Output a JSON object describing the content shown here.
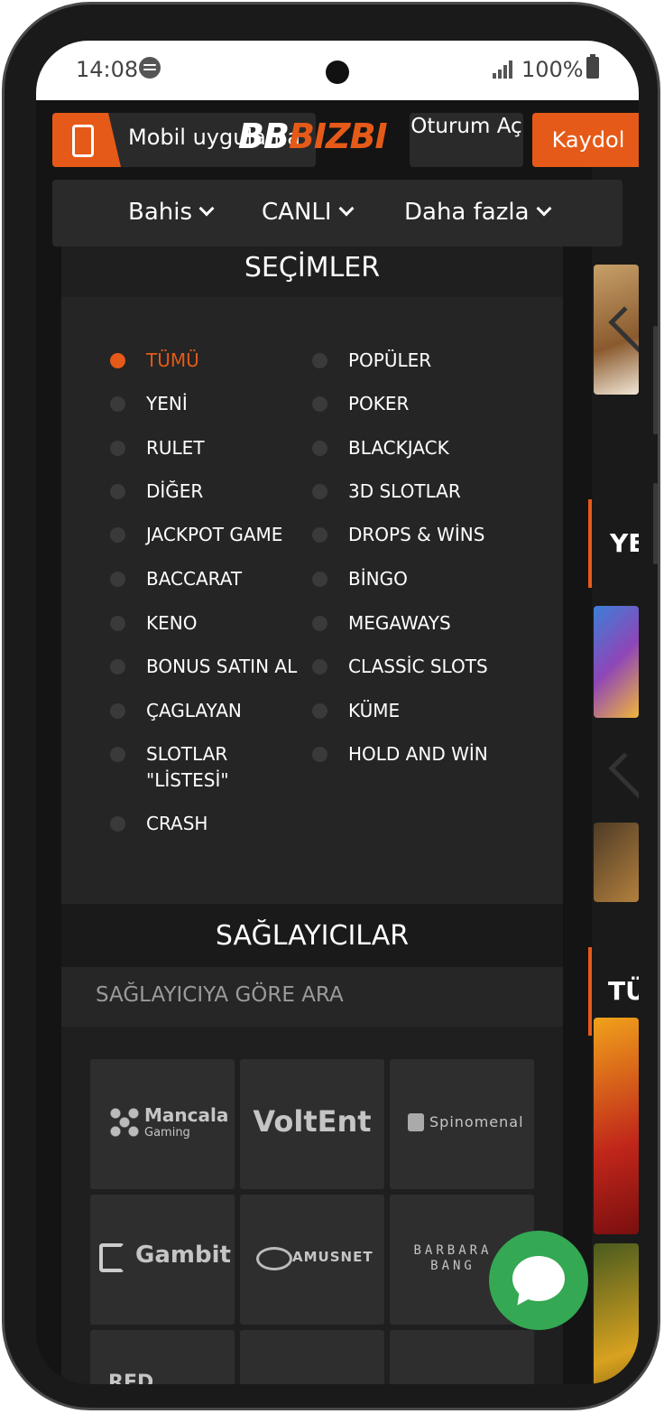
{
  "status_bar": {
    "time": "14:08",
    "battery": "100%"
  },
  "header": {
    "mobile_app_label": "Mobil uygulama",
    "logo_left": "BB",
    "logo_text": "BIZBI",
    "login_label": "Oturum Aç",
    "signup_label": "Kaydol"
  },
  "nav": {
    "items": [
      {
        "label": "Bahis"
      },
      {
        "label": "CANLI"
      },
      {
        "label": "Daha fazla"
      }
    ]
  },
  "selections": {
    "title": "SEÇİMLER",
    "filters": [
      {
        "label": "TÜMÜ",
        "active": true
      },
      {
        "label": "POPÜLER"
      },
      {
        "label": "YENİ"
      },
      {
        "label": "POKER"
      },
      {
        "label": "RULET"
      },
      {
        "label": "BLACKJACK"
      },
      {
        "label": "DİĞER"
      },
      {
        "label": "3D SLOTLAR"
      },
      {
        "label": "JACKPOT GAME"
      },
      {
        "label": "DROPS & WİNS"
      },
      {
        "label": "BACCARAT"
      },
      {
        "label": "BİNGO"
      },
      {
        "label": "KENO"
      },
      {
        "label": "MEGAWAYS"
      },
      {
        "label": "BONUS SATIN AL"
      },
      {
        "label": "CLASSİC SLOTS"
      },
      {
        "label": "ÇAGLAYAN"
      },
      {
        "label": "KÜME"
      },
      {
        "label": "SLOTLAR \"LİSTESİ\""
      },
      {
        "label": "HOLD AND WİN"
      },
      {
        "label": "CRASH"
      }
    ]
  },
  "providers": {
    "title": "SAĞLAYICILAR",
    "search_placeholder": "SAĞLAYICIYA GÖRE ARA",
    "tiles": [
      {
        "name": "Mancala",
        "sub": "Gaming"
      },
      {
        "name": "VoltEnt"
      },
      {
        "name": "Spinomenal"
      },
      {
        "name": "Gambit"
      },
      {
        "name": "AMUSNET"
      },
      {
        "name": "BARBARA BANG"
      },
      {
        "name": "RED"
      }
    ]
  },
  "side_strip": {
    "text_1": "YE",
    "text_2": "TÜ"
  },
  "colors": {
    "accent": "#e55a18",
    "chat": "#34a853",
    "background": "#141414"
  }
}
